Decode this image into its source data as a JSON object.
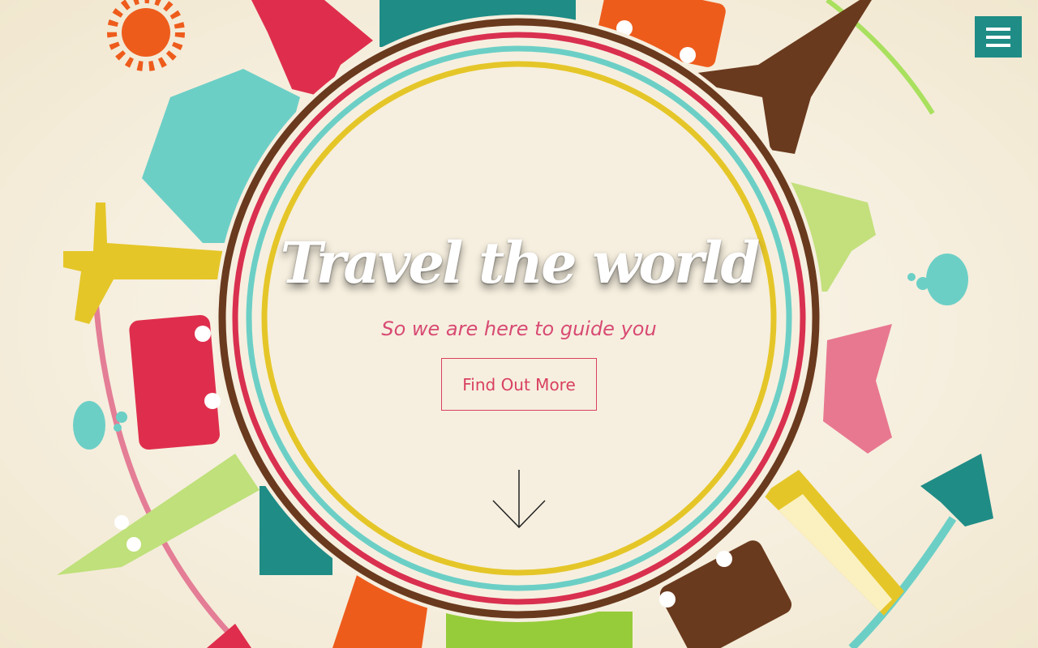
{
  "hero": {
    "title": "Travel the world",
    "subtitle": "So we are here to guide you",
    "cta_label": "Find Out More"
  },
  "nav": {
    "menu_icon": "hamburger-menu-icon"
  },
  "scroll": {
    "icon": "arrow-down-icon"
  },
  "colors": {
    "teal": "#1f8c86",
    "accent_pink": "#d9405f",
    "subtitle_pink": "#d84a73",
    "ring_brown": "#6a3a1e",
    "ring_red": "#d9304f",
    "ring_cyan": "#6ccfc6",
    "ring_yellow": "#e5c628",
    "background": "#f6f0e0"
  }
}
